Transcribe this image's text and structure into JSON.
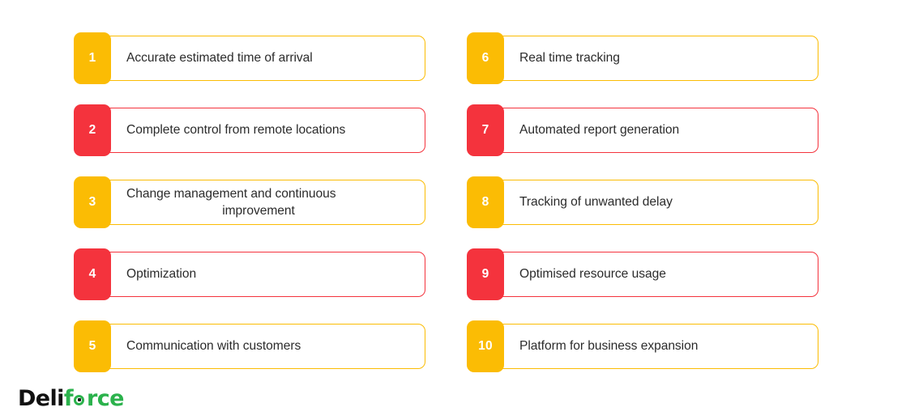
{
  "page": {
    "background_color": "#ffffff",
    "accent_yellow": "#FBBC04",
    "accent_red": "#F4333D",
    "text_color": "#2b2b2b"
  },
  "columns": [
    {
      "name": "left-column",
      "items": [
        {
          "number": "1",
          "label": "Accurate estimated time of arrival",
          "accent": "yellow",
          "lines": null
        },
        {
          "number": "2",
          "label": "Complete control from remote locations",
          "accent": "red",
          "lines": null
        },
        {
          "number": "3",
          "label": "Change management and continuous improvement",
          "accent": "yellow",
          "lines": [
            "Change management and continuous",
            "improvement"
          ]
        },
        {
          "number": "4",
          "label": "Optimization",
          "accent": "red",
          "lines": null
        },
        {
          "number": "5",
          "label": "Communication with customers",
          "accent": "yellow",
          "lines": null
        }
      ]
    },
    {
      "name": "right-column",
      "items": [
        {
          "number": "6",
          "label": "Real time tracking",
          "accent": "yellow",
          "lines": null
        },
        {
          "number": "7",
          "label": "Automated report generation",
          "accent": "red",
          "lines": null
        },
        {
          "number": "8",
          "label": "Tracking of unwanted delay",
          "accent": "yellow",
          "lines": null
        },
        {
          "number": "9",
          "label": "Optimised resource usage",
          "accent": "red",
          "lines": null
        },
        {
          "number": "10",
          "label": "Platform for business expansion",
          "accent": "yellow",
          "lines": null
        }
      ]
    }
  ],
  "logo": {
    "name": "deliforce-logo",
    "part_dark": "Deli",
    "part_f": "f",
    "part_rce": "rce",
    "full_text": "Deliforce",
    "dark_color": "#111111",
    "green_color": "#2BB24C"
  }
}
